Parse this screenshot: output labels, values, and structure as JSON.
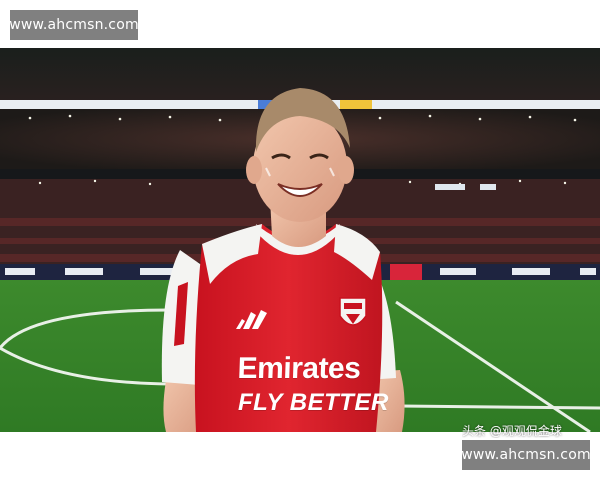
{
  "watermarks": {
    "top": "www.ahcmsn.com",
    "bottom": "www.ahcmsn.com"
  },
  "jersey": {
    "sponsor_line1": "Emirates",
    "sponsor_line2": "FLY BETTER"
  },
  "caption": "头条 @观观侃金球",
  "colors": {
    "jersey_red": "#d81e2b",
    "pitch_green": "#3f8f2f",
    "badge_gray": "#808080"
  }
}
